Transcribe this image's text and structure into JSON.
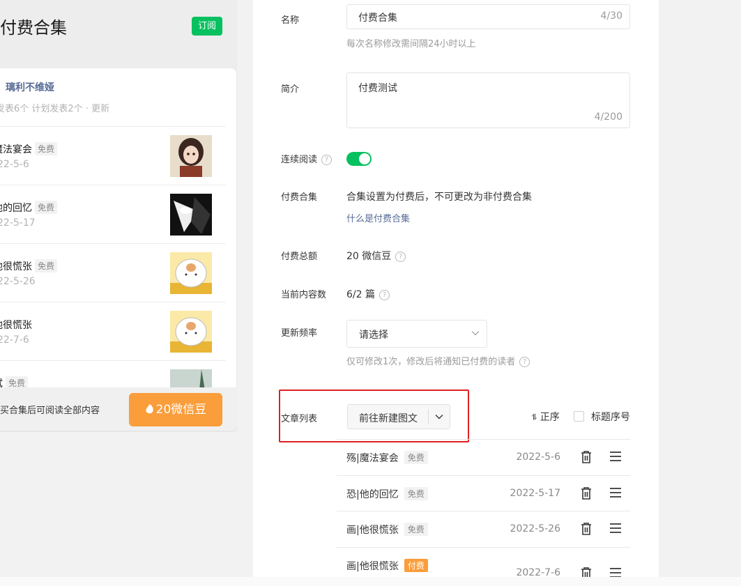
{
  "preview": {
    "title": "付费合集",
    "subscribe_label": "订阅",
    "author": "璃利不维娅",
    "stats": "发表6个 计划发表2个 · 更新",
    "items": [
      {
        "title": "魔法宴会",
        "tag": "免费",
        "date": "22-5-6"
      },
      {
        "title": "他的回忆",
        "tag": "免费",
        "date": "22-5-17"
      },
      {
        "title": "他很慌张",
        "tag": "免费",
        "date": "22-5-26"
      },
      {
        "title": "他很慌张",
        "tag": "",
        "date": "22-7-6"
      },
      {
        "title": "试",
        "tag": "免费",
        "date": ""
      }
    ],
    "footer_note": "买合集后可阅读全部内容",
    "buy_label": "20微信豆"
  },
  "form": {
    "name_label": "名称",
    "name_value": "付费合集",
    "name_count": "4/30",
    "name_hint": "每次名称修改需间隔24小时以上",
    "intro_label": "简介",
    "intro_value": "付费测试",
    "intro_count": "4/200",
    "continuous_label": "连续阅读",
    "paid_label": "付费合集",
    "paid_text": "合集设置为付费后，不可更改为非付费合集",
    "paid_link": "什么是付费合集",
    "total_label": "付费总额",
    "total_value": "20 微信豆",
    "count_label": "当前内容数",
    "count_value": "6/2 篇",
    "freq_label": "更新频率",
    "freq_value": "请选择",
    "freq_hint": "仅可修改1次，修改后将通知已付费的读者",
    "list_label": "文章列表",
    "new_article": "前往新建图文",
    "sort_label": "正序",
    "serial_label": "标题序号",
    "articles": [
      {
        "title": "殇|魔法宴会",
        "tag": "免费",
        "paid": false,
        "date": "2022-5-6"
      },
      {
        "title": "恐|他的回忆",
        "tag": "免费",
        "paid": false,
        "date": "2022-5-17"
      },
      {
        "title": "画|他很慌张",
        "tag": "免费",
        "paid": false,
        "date": "2022-5-26"
      },
      {
        "title": "画|他很慌张",
        "tag": "付费",
        "paid": true,
        "date": "2022-7-6"
      }
    ]
  },
  "colors": {
    "accent": "#07c160",
    "paid": "#fa9d3b",
    "link": "#576b95",
    "highlight": "#e02020"
  }
}
